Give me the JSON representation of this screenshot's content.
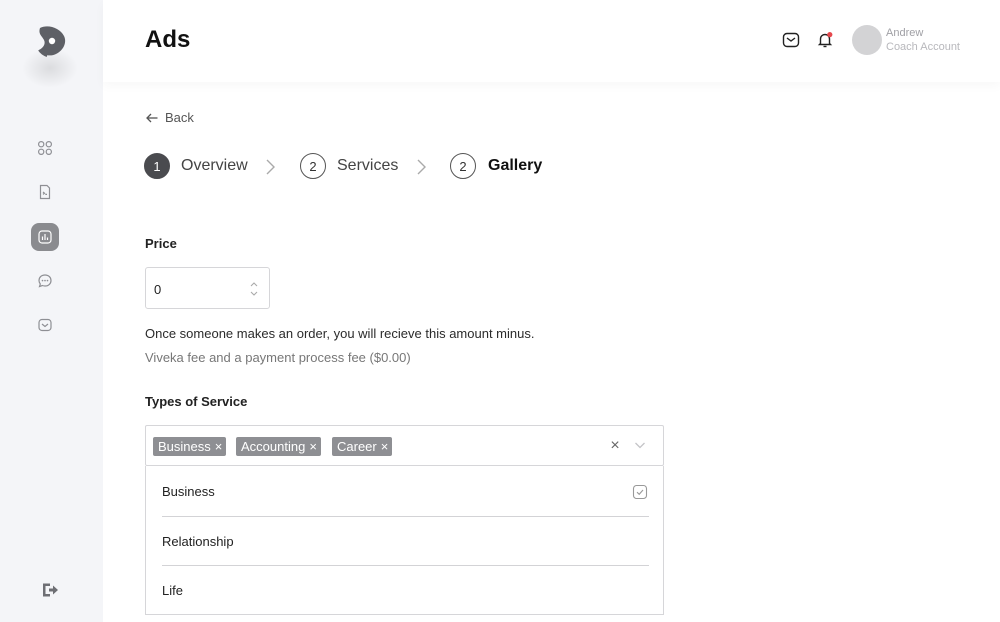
{
  "header": {
    "title": "Ads",
    "user_name": "Andrew",
    "user_role": "Coach Account"
  },
  "sidebar": {
    "items": [
      {
        "icon": "grid-icon",
        "active": false
      },
      {
        "icon": "document-icon",
        "active": false
      },
      {
        "icon": "chart-icon",
        "active": true
      },
      {
        "icon": "chat-icon",
        "active": false
      },
      {
        "icon": "inbox-icon",
        "active": false
      }
    ],
    "logout_icon": "logout-icon"
  },
  "nav": {
    "back_label": "Back"
  },
  "steps": [
    {
      "number": "1",
      "label": "Overview",
      "state": "done"
    },
    {
      "number": "2",
      "label": "Services",
      "state": "default"
    },
    {
      "number": "2",
      "label": "Gallery",
      "state": "current"
    }
  ],
  "price": {
    "label": "Price",
    "value": "0",
    "note_line1": "Once someone makes an order, you will recieve this amount minus.",
    "note_line2": "Viveka fee and a payment process fee ($0.00)"
  },
  "service_types": {
    "label": "Types of Service",
    "selected": [
      "Business",
      "Accounting",
      "Career"
    ],
    "tag_remove_glyph": "×",
    "clear_glyph": "×",
    "options": [
      {
        "label": "Business",
        "checked": true
      },
      {
        "label": "Relationship",
        "checked": false
      },
      {
        "label": "Life",
        "checked": false
      }
    ]
  },
  "colors": {
    "sidebar_bg": "#f4f5f8",
    "active_nav": "#8a8b8f",
    "tag_bg": "#8e8f93",
    "notification_dot": "#e5484d"
  }
}
